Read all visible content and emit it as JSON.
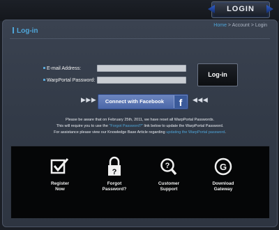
{
  "header": {
    "badge_label": "LOGIN"
  },
  "page": {
    "title": "Log-in",
    "breadcrumb": {
      "home": "Home",
      "sep1": " > ",
      "account": "Account",
      "sep2": " > ",
      "current": "Login"
    }
  },
  "form": {
    "email_label": "E-mail Address:",
    "email_value": "",
    "password_label": "WarpPortal Password:",
    "password_value": "",
    "login_button": "Log-in",
    "facebook_button": "Connect with Facebook",
    "facebook_logo": "f",
    "arrows_left": "▶ ▶ ▶",
    "arrows_right": "◀ ◀ ◀"
  },
  "notice": {
    "line1": "Please be aware that on February 25th, 2011, we have reset all WarpPortal Passwords.",
    "line2_pre": "This will require you to use the ",
    "line2_link": "\"Forgot Password?\"",
    "line2_post": " link below to update the WarpPortal Password.",
    "line3_pre": "For assistance please view our Knowledge Base Article regarding ",
    "line3_link": "updating the WarpPortal password",
    "line3_post": "."
  },
  "actions": [
    {
      "line1": "Register",
      "line2": "Now",
      "icon": "register-icon"
    },
    {
      "line1": "Forgot",
      "line2": "Password?",
      "icon": "lock-icon"
    },
    {
      "line1": "Customer",
      "line2": "Support",
      "icon": "search-help-icon"
    },
    {
      "line1": "Download",
      "line2": "Gateway",
      "icon": "gateway-icon"
    }
  ],
  "colors": {
    "accent": "#4fa6d9",
    "facebook": "#4b67a8",
    "background": "#1a1e25"
  }
}
